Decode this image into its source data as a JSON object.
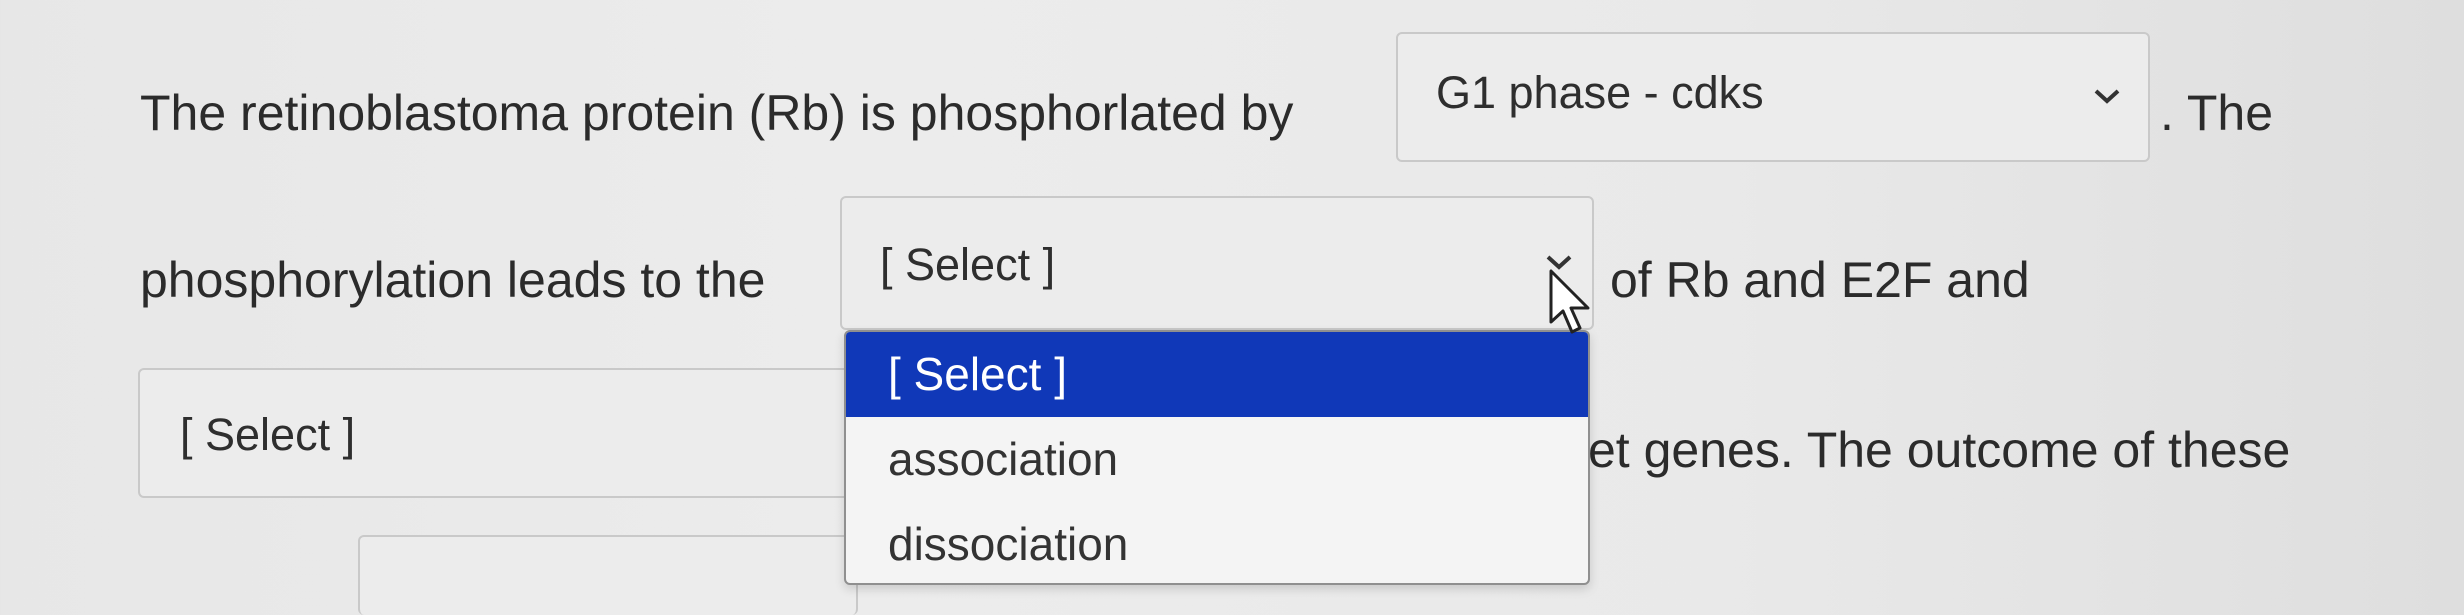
{
  "question": {
    "line1_prefix": "The retinoblastoma protein (Rb) is phosphorlated by",
    "line1_suffix": ". The",
    "line2_prefix": "phosphorylation leads to the",
    "line2_suffix": "of Rb and E2F and",
    "line3_suffix": "et genes.  The outcome of these"
  },
  "dropdowns": {
    "first": {
      "value": "G1 phase - cdks"
    },
    "second": {
      "value": "[ Select ]"
    },
    "third": {
      "value": "[ Select ]"
    }
  },
  "dropdown_menu": {
    "options": [
      "[ Select ]",
      "association",
      "dissociation"
    ],
    "highlighted": "[ Select ]"
  },
  "icons": {
    "chevron": "chevron-down-icon",
    "cursor": "mouse-pointer-icon"
  },
  "colors": {
    "highlight": "#1038b8",
    "background": "#e9e9e9"
  }
}
